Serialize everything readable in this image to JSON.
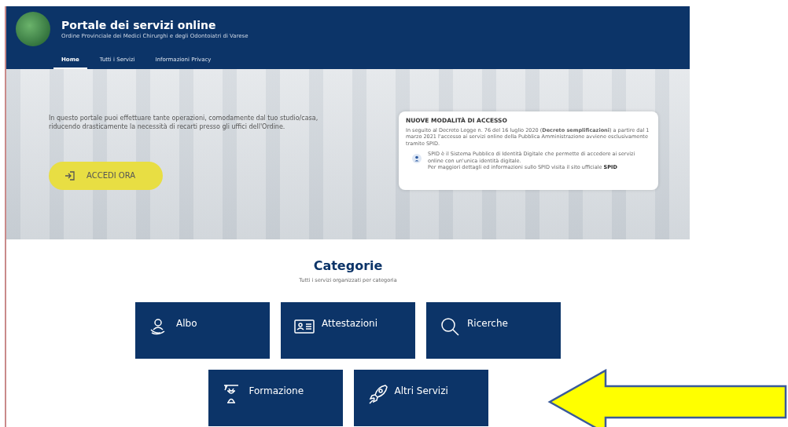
{
  "header": {
    "title": "Portale dei servizi online",
    "subtitle": "Ordine Provinciale dei Medici Chirurghi e degli Odontoiatri di Varese"
  },
  "nav": [
    {
      "label": "Home",
      "selected": true
    },
    {
      "label": "Tutti i Servizi",
      "selected": false
    },
    {
      "label": "Informazioni Privacy",
      "selected": false
    }
  ],
  "hero": {
    "text": "In questo portale puoi effettuare tante operazioni, comodamente dal tuo studio/casa, riducendo drasticamente la necessità di recarti presso gli uffici dell'Ordine.",
    "button": "ACCEDI ORA"
  },
  "access_card": {
    "title": "NUOVE MODALITÀ DI ACCESSO",
    "text": "In seguito al Decreto Legge n. 76 del 16 luglio 2020 (**Decreto semplificazioni**) a partire dal 1 marzo 2021 l'accesso ai servizi online della Pubblica Amministrazione avviene esclusivamente tramite SPID.",
    "note": "SPID è il Sistema Pubblico di Identità Digitale che permette di accedere ai servizi online con un'unica identità digitale.",
    "note_link_text": "Per maggiori dettagli ed informazioni sullo SPID visita il sito ufficiale",
    "note_link": "SPID"
  },
  "categories": {
    "title": "Categorie",
    "subtitle": "Tutti i servizi organizzati per categoria",
    "items": [
      {
        "label": "Albo",
        "kind": "register"
      },
      {
        "label": "Attestazioni",
        "kind": "certificate"
      },
      {
        "label": "Ricerche",
        "kind": "search"
      },
      {
        "label": "Formazione",
        "kind": "training"
      },
      {
        "label": "Altri Servizi",
        "kind": "rocket"
      }
    ]
  }
}
